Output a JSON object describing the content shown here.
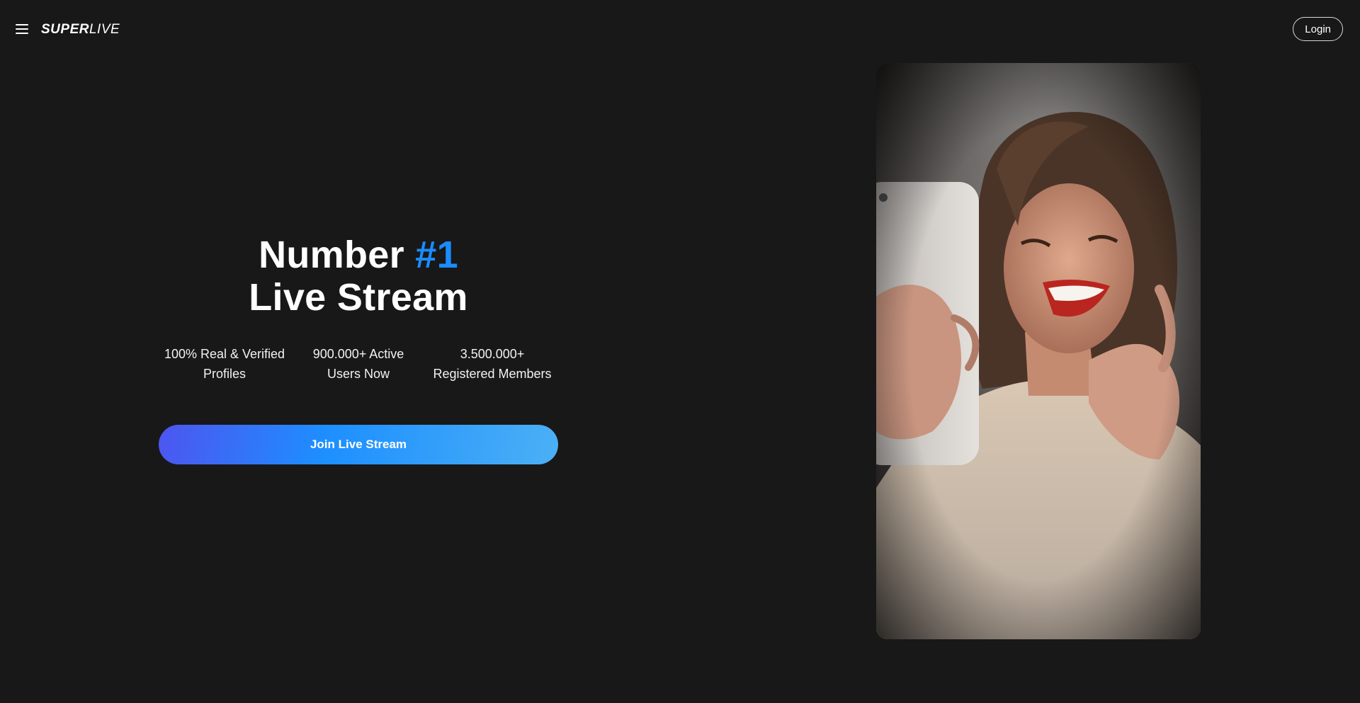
{
  "header": {
    "menu_icon": "hamburger-menu-icon",
    "logo": {
      "bold_part": "SUPER",
      "light_part": "LIVE"
    },
    "login_label": "Login"
  },
  "hero": {
    "headline_prefix": "Number ",
    "headline_accent": "#1",
    "headline_line2": "Live Stream",
    "accent_color": "#1a8cff",
    "stats": [
      {
        "line1": "100% Real & Verified",
        "line2": "Profiles"
      },
      {
        "line1": "900.000+ Active",
        "line2": "Users Now"
      },
      {
        "line1": "3.500.000+",
        "line2": "Registered Members"
      }
    ],
    "cta_label": "Join Live Stream"
  },
  "media": {
    "preview_image": "woman-taking-selfie-video-preview"
  },
  "colors": {
    "background": "#181818",
    "cta_gradient_start": "#4d55f0",
    "cta_gradient_mid": "#1d8fff",
    "cta_gradient_end": "#4cb0f5"
  }
}
